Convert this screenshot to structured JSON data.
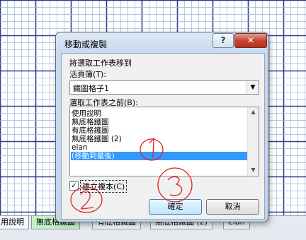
{
  "sheet_tabs": [
    {
      "label": "用說明",
      "active": false
    },
    {
      "label": "無底格鐵圖",
      "active": true
    },
    {
      "label": "有底格鐵圖",
      "active": false
    },
    {
      "label": "無底格鐵圖 (2)",
      "active": false
    },
    {
      "label": "elan",
      "active": false
    }
  ],
  "dialog": {
    "title": "移動或複製",
    "help_label": "?",
    "close_label": "✕",
    "move_prompt": "將選取工作表移到",
    "book_label": "活頁簿(T):",
    "book_value": "鐵圖格子1",
    "before_label": "選取工作表之前(B):",
    "sheets": [
      "使用說明",
      "無底格鐵圖",
      "有底格鐵圖",
      "無底格鐵圖 (2)",
      "elan",
      "(移動到最後)"
    ],
    "selected_index": 5,
    "create_copy_label": "建立複本(C)",
    "create_copy_checked": true,
    "ok_label": "確定",
    "cancel_label": "取消"
  },
  "annotations": [
    "1",
    "2",
    "3"
  ],
  "colors": {
    "grid_major": "#2b3f8f",
    "grid_minor": "#9fb4d8",
    "annotation": "#e0201a",
    "selection": "#3399ff"
  }
}
